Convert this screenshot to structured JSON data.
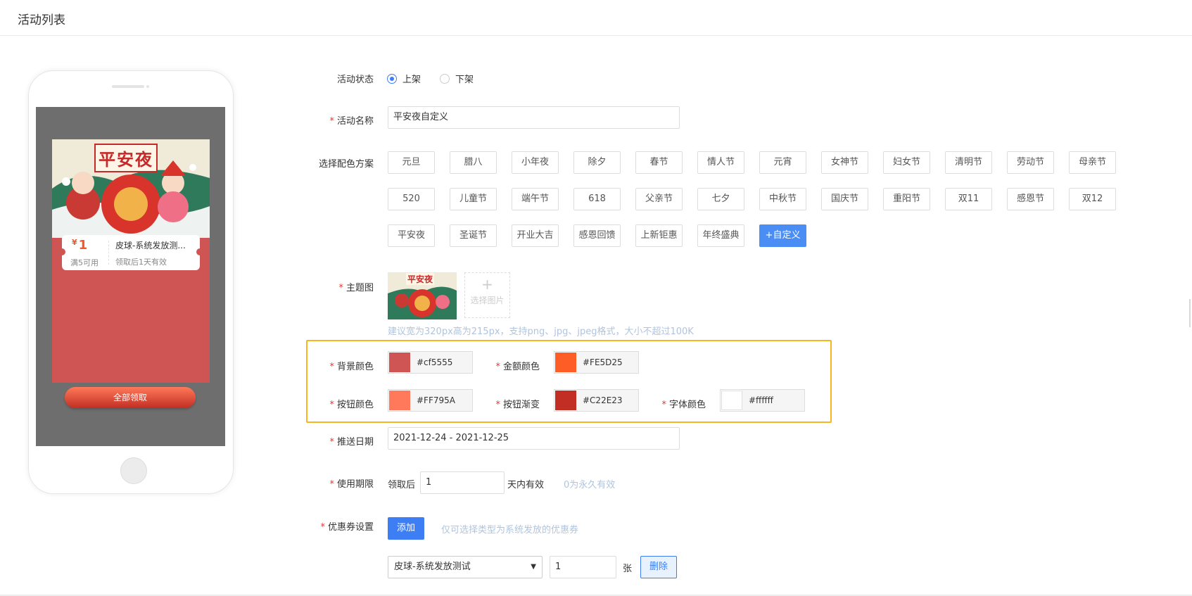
{
  "header": {
    "title": "活动列表"
  },
  "preview": {
    "poster_title": "平安夜",
    "seal_text": "平安",
    "coupon": {
      "currency": "¥",
      "amount": "1",
      "condition": "满5可用",
      "name": "皮球-系统发放测...",
      "validity": "领取后1天有效"
    },
    "claim_button": "全部领取"
  },
  "form": {
    "status": {
      "label": "活动状态",
      "options": [
        "上架",
        "下架"
      ],
      "selected": "上架"
    },
    "name": {
      "label": "活动名称",
      "value": "平安夜自定义"
    },
    "scheme": {
      "label": "选择配色方案",
      "options": [
        "元旦",
        "腊八",
        "小年夜",
        "除夕",
        "春节",
        "情人节",
        "元宵",
        "女神节",
        "妇女节",
        "清明节",
        "劳动节",
        "母亲节",
        "520",
        "儿童节",
        "端午节",
        "618",
        "父亲节",
        "七夕",
        "中秋节",
        "国庆节",
        "重阳节",
        "双11",
        "感恩节",
        "双12",
        "平安夜",
        "圣诞节",
        "开业大吉",
        "感恩回馈",
        "上新钜惠",
        "年终盛典",
        "+自定义"
      ],
      "selected": "+自定义"
    },
    "theme_image": {
      "label": "主题图",
      "thumb_title": "平安夜",
      "upload_text": "选择图片",
      "hint": "建议宽为320px高为215px，支持png、jpg、jpeg格式，大小不超过100K"
    },
    "colors": {
      "bg": {
        "label": "背景颜色",
        "value": "#cf5555"
      },
      "amount": {
        "label": "金额颜色",
        "value": "#FE5D25"
      },
      "button": {
        "label": "按钮颜色",
        "value": "#FF795A"
      },
      "gradient": {
        "label": "按钮渐变",
        "value": "#C22E23"
      },
      "font": {
        "label": "字体颜色",
        "value": "#ffffff"
      }
    },
    "push_date": {
      "label": "推送日期",
      "value": "2021-12-24 - 2021-12-25"
    },
    "usage": {
      "label": "使用期限",
      "prefix": "领取后",
      "value": "1",
      "suffix": "天内有效",
      "hint": "0为永久有效"
    },
    "coupon_setting": {
      "label": "优惠券设置",
      "add_button": "添加",
      "hint": "仅可选择类型为系统发放的优惠券",
      "selected_coupon": "皮球-系统发放测试",
      "quantity": "1",
      "unit": "张",
      "delete_button": "删除"
    }
  }
}
